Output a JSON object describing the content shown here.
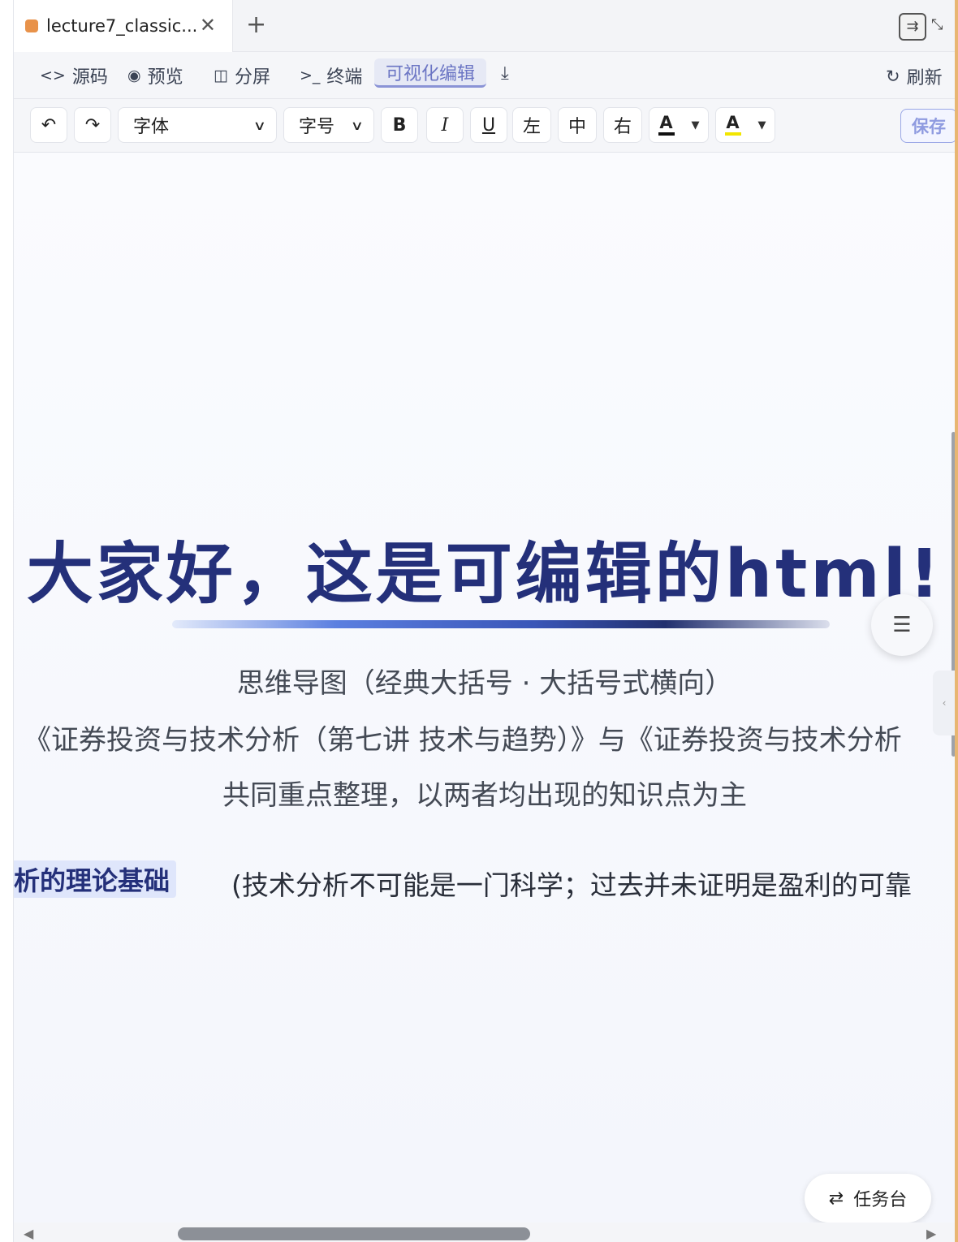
{
  "tab": {
    "title": "lecture7_classic...",
    "close": "✕",
    "add": "+"
  },
  "window_controls": {
    "layout_icon": "⇉",
    "collapse_icon": "⤡"
  },
  "viewbar": {
    "source": {
      "icon": "<>",
      "label": "源码"
    },
    "preview": {
      "icon": "◉",
      "label": "预览"
    },
    "split": {
      "icon": "◫",
      "label": "分屏"
    },
    "terminal": {
      "icon": ">_",
      "label": "终端"
    },
    "visual_edit": {
      "label": "可视化编辑"
    },
    "download_icon": "⤓",
    "refresh": {
      "icon": "↻",
      "label": "刷新"
    }
  },
  "format": {
    "undo": "↶",
    "redo": "↷",
    "font": "字体",
    "size": "字号",
    "bold": "B",
    "italic": "I",
    "underline": "U",
    "left": "左",
    "center": "中",
    "right": "右",
    "text_color": {
      "label": "A",
      "bar": "#111111"
    },
    "highlight": {
      "label": "A",
      "bar": "#f2e600"
    },
    "save": "保存"
  },
  "content": {
    "headline": "大家好，这是可编辑的html!",
    "sub1": "思维导图（经典大括号 · 大括号式横向）",
    "sub2": "《证券投资与技术分析（第七讲 技术与趋势）》与《证券投资与技术分析",
    "sub3": "共同重点整理，以两者均出现的知识点为主",
    "node_label": "析的理论基础",
    "node_text": "(技术分析不可能是一门科学；过去并未证明是盈利的可靠"
  },
  "toc_icon": "☰",
  "side_handle": "‹",
  "task": {
    "icon": "⇄",
    "label": "任务台"
  },
  "hscroll": {
    "left": "◀",
    "right": "▶"
  },
  "colors": {
    "accent": "#24307a",
    "active_tab": "#6b75c4",
    "save": "#8f9be0",
    "tab_dot": "#e8924a"
  }
}
